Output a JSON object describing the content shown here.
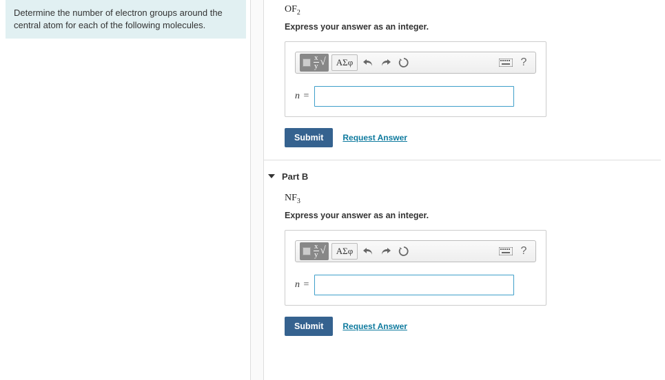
{
  "sidebar": {
    "prompt": "Determine the number of electron groups around the central atom for each of the following molecules."
  },
  "toolbar": {
    "greek_label": "ΑΣφ",
    "help_label": "?"
  },
  "parts": {
    "a": {
      "molecule_base": "OF",
      "molecule_sub": "2",
      "instruction": "Express your answer as an integer.",
      "var": "n",
      "eq": "=",
      "value": "",
      "submit": "Submit",
      "request": "Request Answer"
    },
    "b": {
      "title": "Part B",
      "molecule_base": "NF",
      "molecule_sub": "3",
      "instruction": "Express your answer as an integer.",
      "var": "n",
      "eq": "=",
      "value": "",
      "submit": "Submit",
      "request": "Request Answer"
    }
  }
}
